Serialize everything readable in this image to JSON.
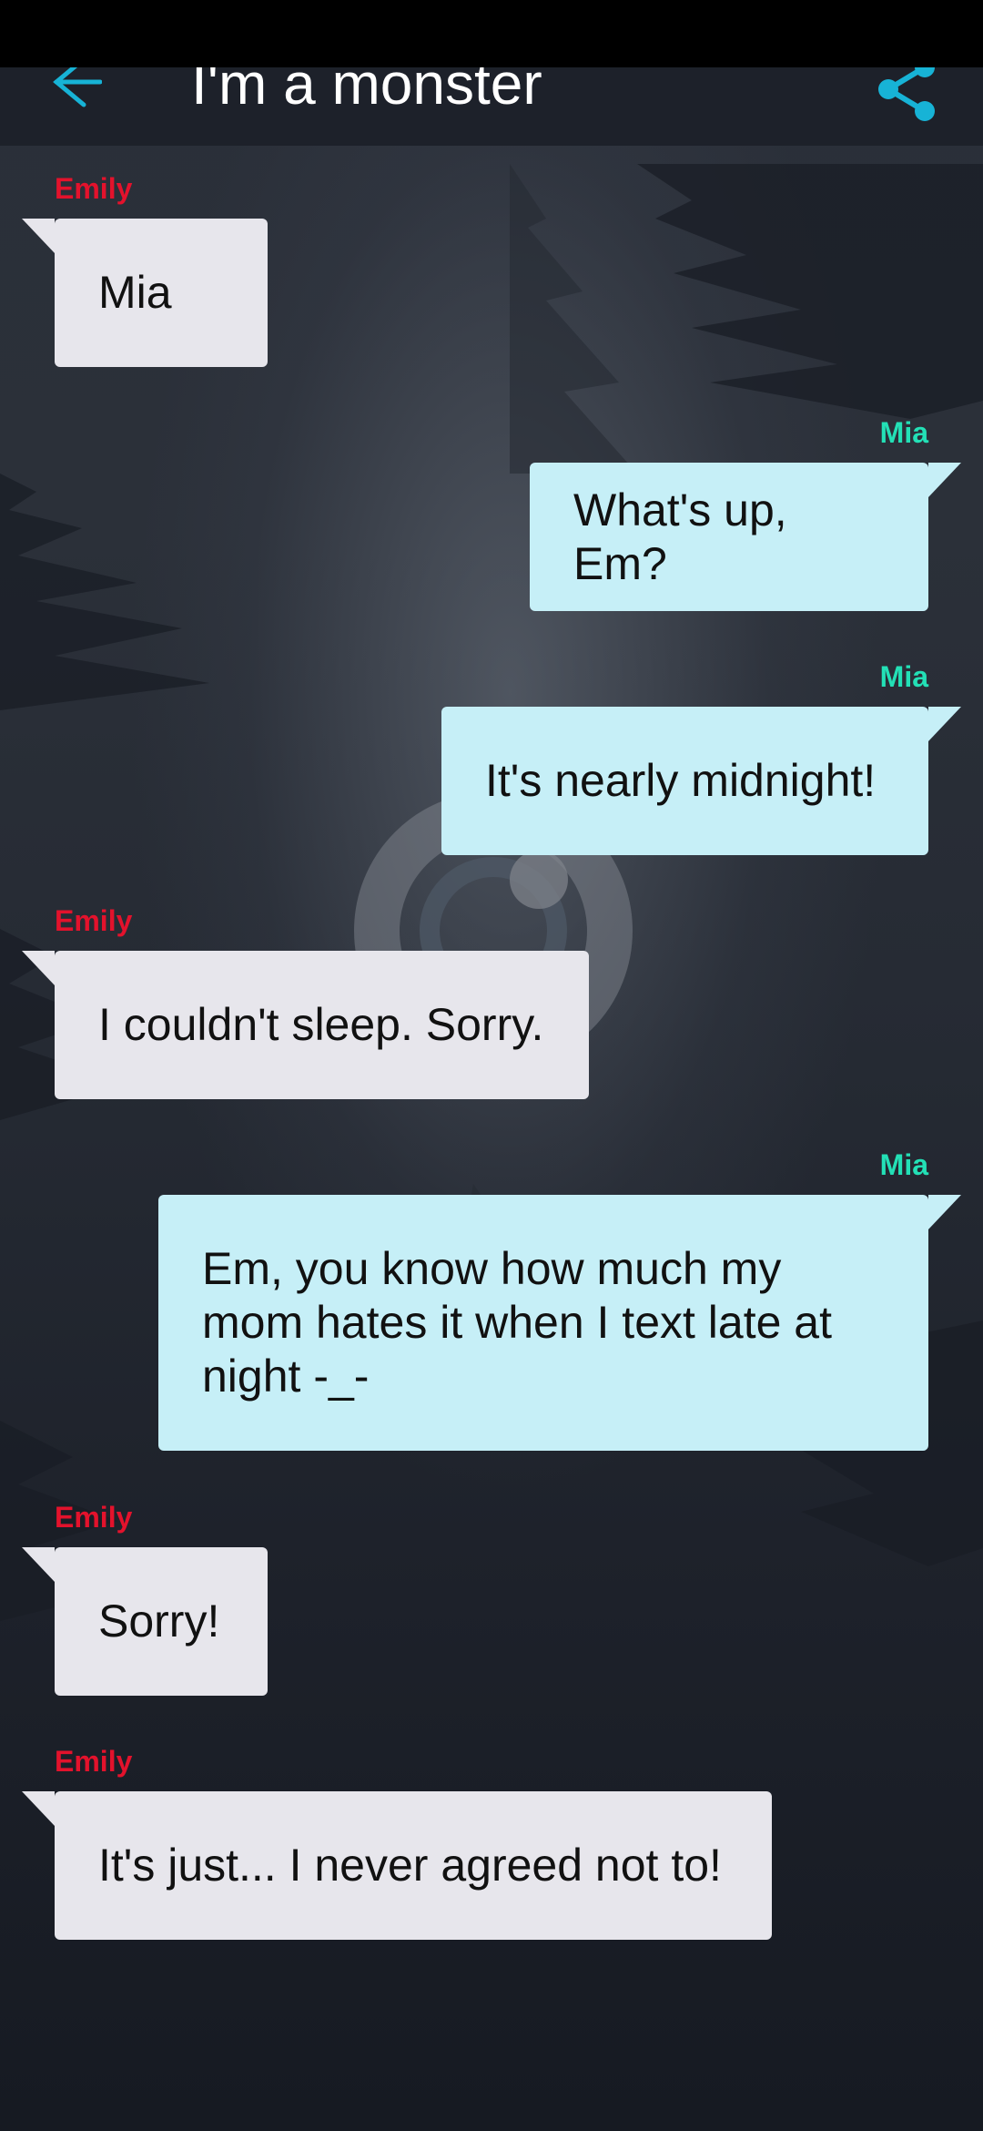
{
  "header": {
    "title": "I'm a monster",
    "back_icon": "arrow-left-icon",
    "share_icon": "share-icon"
  },
  "colors": {
    "accent": "#17b3d6",
    "sender_left": "#e3122c",
    "sender_right": "#23e0b6",
    "bubble_left": "#e7e6ec",
    "bubble_right": "#c6eff7"
  },
  "messages": [
    {
      "sender": "Emily",
      "side": "left",
      "text": "Mia"
    },
    {
      "sender": "Mia",
      "side": "right",
      "text": "What's up, Em?"
    },
    {
      "sender": "Mia",
      "side": "right",
      "text": "It's nearly midnight!"
    },
    {
      "sender": "Emily",
      "side": "left",
      "text": "I couldn't sleep. Sorry."
    },
    {
      "sender": "Mia",
      "side": "right",
      "text": "Em, you know how much my mom hates it when I text late at night -_-"
    },
    {
      "sender": "Emily",
      "side": "left",
      "text": "Sorry!"
    },
    {
      "sender": "Emily",
      "side": "left",
      "text": "It's just... I never agreed not to!"
    }
  ]
}
